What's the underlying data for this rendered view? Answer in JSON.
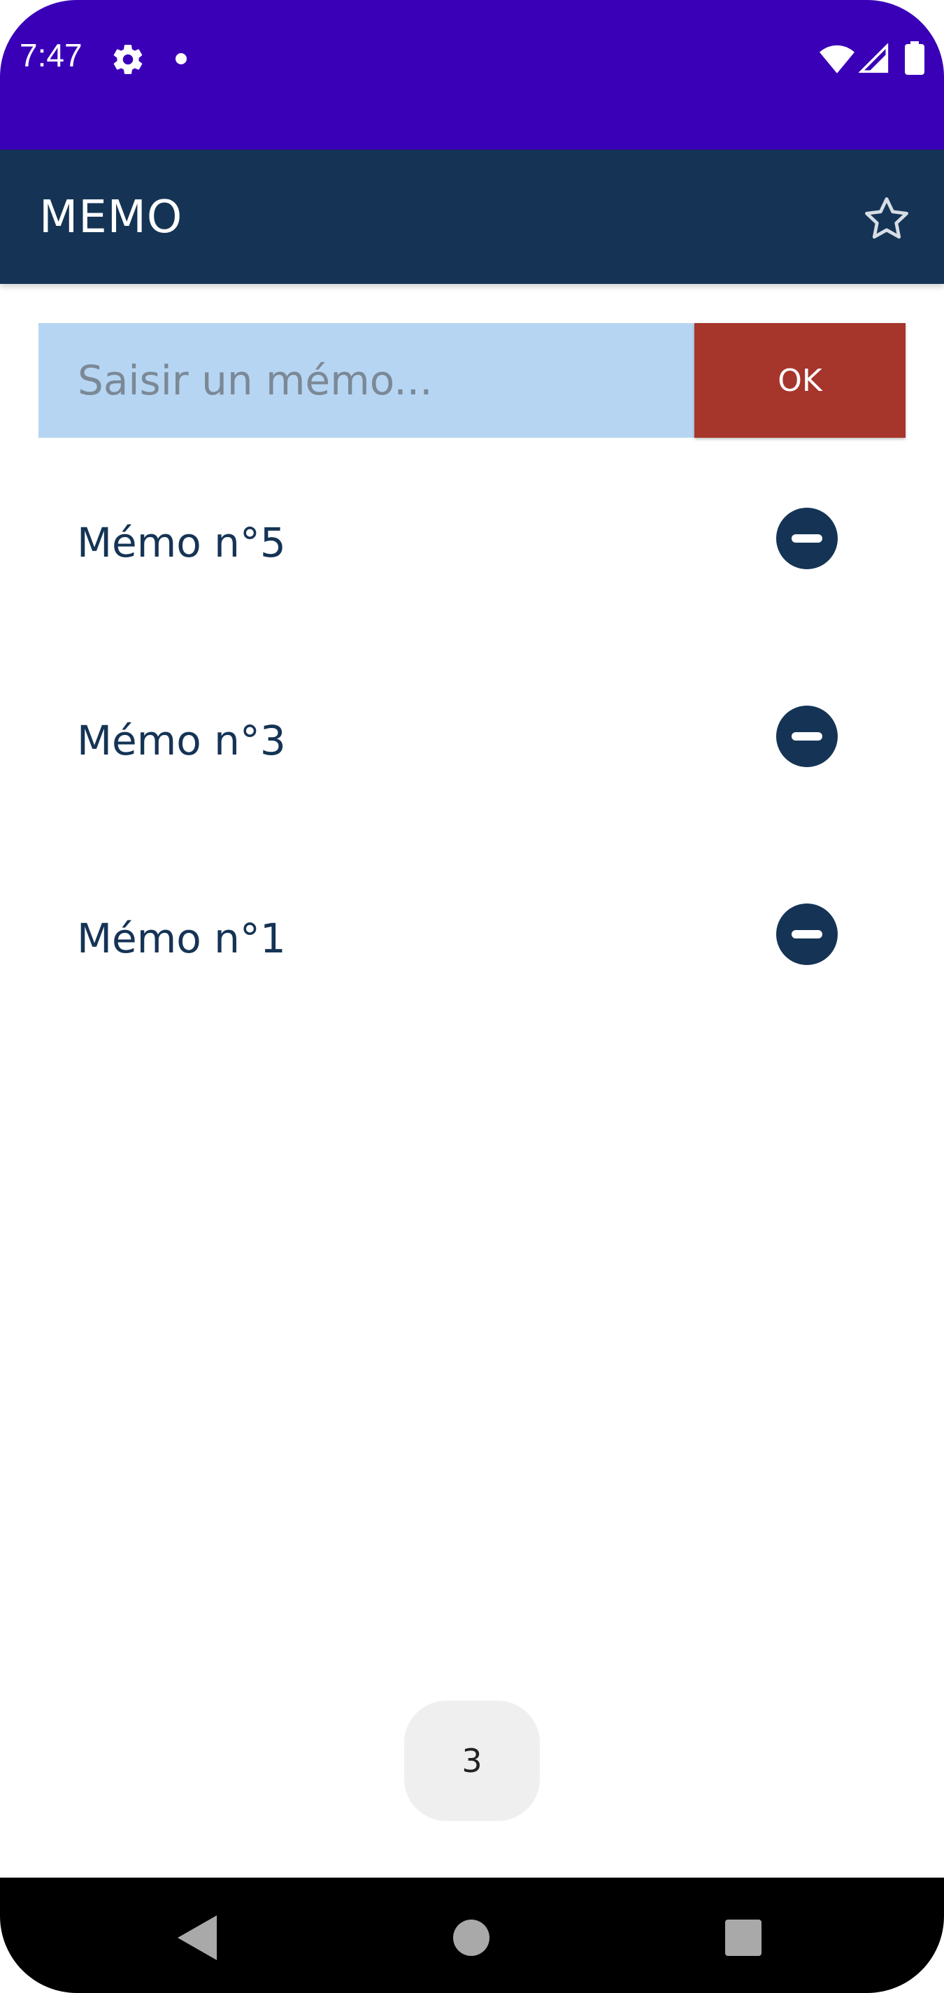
{
  "status_bar": {
    "time": "7:47",
    "background_color": "#3a00b8",
    "icons": [
      "gear-icon",
      "notification-dot-icon",
      "wifi-icon",
      "signal-icon",
      "battery-icon"
    ]
  },
  "app_bar": {
    "title": "MEMO",
    "background_color": "#153455",
    "action_icon": "star-outline-icon"
  },
  "memo_form": {
    "input_value": "",
    "input_placeholder": "Saisir un mémo...",
    "submit_label": "OK",
    "input_background": "#b6d5f2",
    "submit_background": "#a6352b"
  },
  "memos": [
    {
      "label": "Mémo n°5",
      "action_icon": "minus-circle-icon"
    },
    {
      "label": "Mémo n°3",
      "action_icon": "minus-circle-icon"
    },
    {
      "label": "Mémo n°1",
      "action_icon": "minus-circle-icon"
    }
  ],
  "memo_count": "3",
  "nav_bar": {
    "buttons": [
      "back-icon",
      "home-icon",
      "recents-icon"
    ]
  }
}
